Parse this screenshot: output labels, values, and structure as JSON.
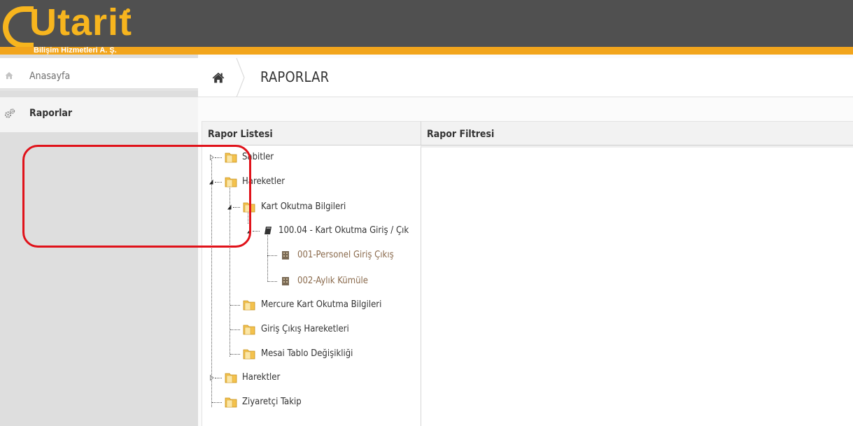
{
  "brand": {
    "logo_text": "Utarit",
    "tagline": "Bilişim Hizmetleri A. Ş.",
    "colors": {
      "header_bg": "#505050",
      "accent": "#f2a51c"
    }
  },
  "sidebar": {
    "items": [
      {
        "label": "Anasayfa",
        "icon": "home-icon"
      },
      {
        "label": "Raporlar",
        "icon": "cogs-icon"
      }
    ]
  },
  "page": {
    "title": "RAPORLAR",
    "home_icon": "home-icon"
  },
  "panels": {
    "list_title": "Rapor Listesi",
    "filter_title": "Rapor Filtresi"
  },
  "tree": {
    "nodes": [
      {
        "label": "Sabitler",
        "type": "folder",
        "state": "collapsed"
      },
      {
        "label": "Hareketler",
        "type": "folder",
        "state": "expanded"
      },
      {
        "label": "Kart Okutma Bilgileri",
        "type": "folder",
        "state": "expanded"
      },
      {
        "label": "100.04 - Kart Okutma Giriş / Çık",
        "type": "document",
        "state": "expanded"
      },
      {
        "label": "001-Personel Giriş Çıkış",
        "type": "report"
      },
      {
        "label": "002-Aylık Kümüle",
        "type": "report"
      },
      {
        "label": "Mercure Kart Okutma Bilgileri",
        "type": "folder"
      },
      {
        "label": "Giriş Çıkış Hareketleri",
        "type": "folder"
      },
      {
        "label": "Mesai Tablo Değişikliği",
        "type": "folder"
      },
      {
        "label": "Harektler",
        "type": "folder",
        "state": "collapsed"
      },
      {
        "label": "Ziyaretçi Takip",
        "type": "folder"
      }
    ],
    "highlight_color": "#e0121a"
  }
}
